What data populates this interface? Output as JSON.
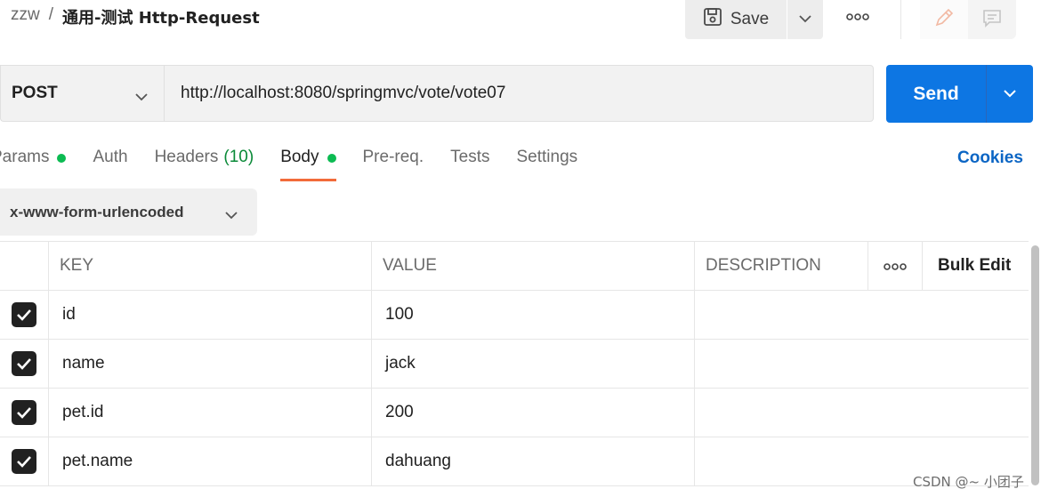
{
  "breadcrumb": {
    "workspace": "zzw",
    "separator": "/",
    "request_name": "通用-测试 Http-Request"
  },
  "toolbar": {
    "save_label": "Save"
  },
  "request": {
    "method": "POST",
    "url": "http://localhost:8080/springmvc/vote/vote07",
    "send_label": "Send"
  },
  "tabs": [
    {
      "label": "Params",
      "dot": true
    },
    {
      "label": "Auth"
    },
    {
      "label": "Headers",
      "count": "(10)"
    },
    {
      "label": "Body",
      "dot": true,
      "active": true
    },
    {
      "label": "Pre-req."
    },
    {
      "label": "Tests"
    },
    {
      "label": "Settings"
    }
  ],
  "cookies_label": "Cookies",
  "body_type": "x-www-form-urlencoded",
  "table": {
    "headers": {
      "key": "KEY",
      "value": "VALUE",
      "description": "DESCRIPTION",
      "bulk_edit": "Bulk Edit"
    },
    "rows": [
      {
        "checked": true,
        "key": "id",
        "value": "100",
        "description": ""
      },
      {
        "checked": true,
        "key": "name",
        "value": "jack",
        "description": ""
      },
      {
        "checked": true,
        "key": "pet.id",
        "value": "200",
        "description": ""
      },
      {
        "checked": true,
        "key": "pet.name",
        "value": "dahuang",
        "description": ""
      }
    ]
  },
  "watermark": "CSDN @~ 小团子",
  "colors": {
    "accent": "#0d76e3",
    "active_tab": "#f26b3a",
    "status_dot": "#0cbb52"
  },
  "icons": [
    "save-icon",
    "chevron-down-icon",
    "more-icon",
    "edit-icon",
    "comment-icon",
    "checkbox-checked-icon"
  ]
}
